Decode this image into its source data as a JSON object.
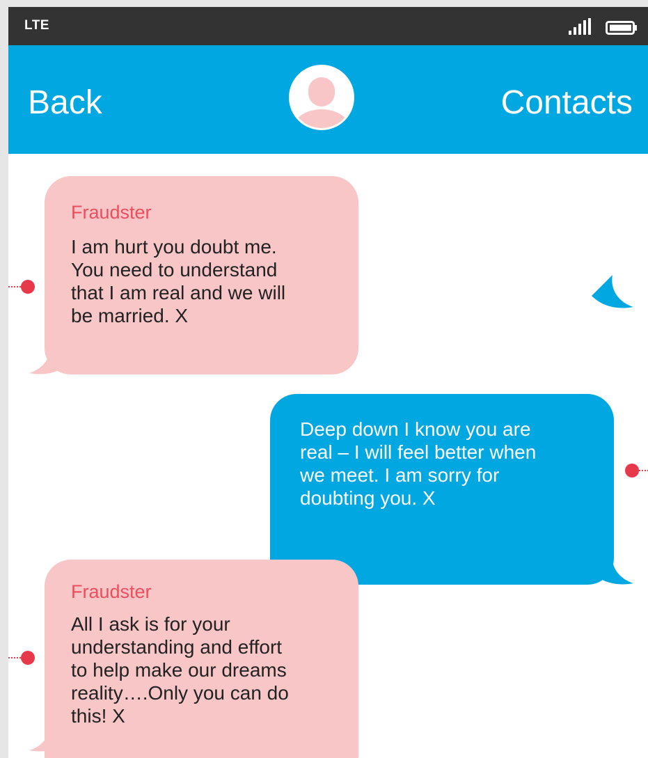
{
  "status_bar": {
    "carrier": "LTE",
    "signal_icon": "signal-bars-icon",
    "battery_icon": "battery-icon"
  },
  "nav": {
    "back_label": "Back",
    "contacts_label": "Contacts",
    "avatar_icon": "person-avatar-icon"
  },
  "messages": [
    {
      "direction": "incoming",
      "sender": "Fraudster",
      "lines": [
        "I am hurt you doubt me.",
        "You need to understand",
        "that I am real and we will",
        "be married. X"
      ]
    },
    {
      "direction": "outgoing",
      "sender": "",
      "lines": [
        "Deep down I know you are",
        "real – I will feel better when",
        "we meet. I am sorry for",
        "doubting you. X"
      ]
    },
    {
      "direction": "incoming",
      "sender": "Fraudster",
      "lines": [
        "All I ask is for your",
        "understanding and effort",
        "to help make our dreams",
        "reality….Only you can do",
        "this! X"
      ]
    }
  ],
  "colors": {
    "status_bar": "#333333",
    "accent_blue": "#00a7e1",
    "incoming_bubble": "#f8c6c6",
    "sender_name": "#ea4e5f",
    "pointer_dot": "#e8394a"
  }
}
